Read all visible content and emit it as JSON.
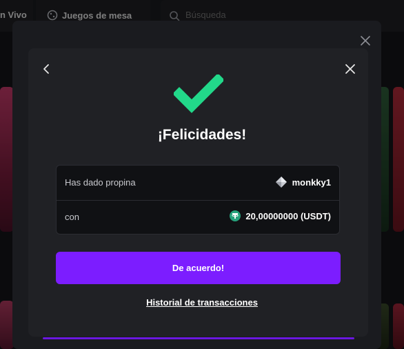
{
  "nav": {
    "live_label": "n Vivo",
    "board_games_label": "Juegos de mesa",
    "search_placeholder": "Búsqueda"
  },
  "modal": {
    "title": "¡Felicidades!",
    "row1": {
      "label": "Has dado propina",
      "value": "monkky1"
    },
    "row2": {
      "label": "con",
      "value": "20,00000000 (USDT)"
    },
    "confirm_label": "De acuerdo!",
    "history_label": "Historial de transacciones"
  },
  "colors": {
    "accent": "#7c1dff",
    "success": "#22d88a",
    "usdt": "#26a17b"
  },
  "icons": [
    "dice-icon",
    "search-icon",
    "close-icon",
    "back-icon",
    "check-icon",
    "diamond-icon",
    "usdt-icon"
  ]
}
